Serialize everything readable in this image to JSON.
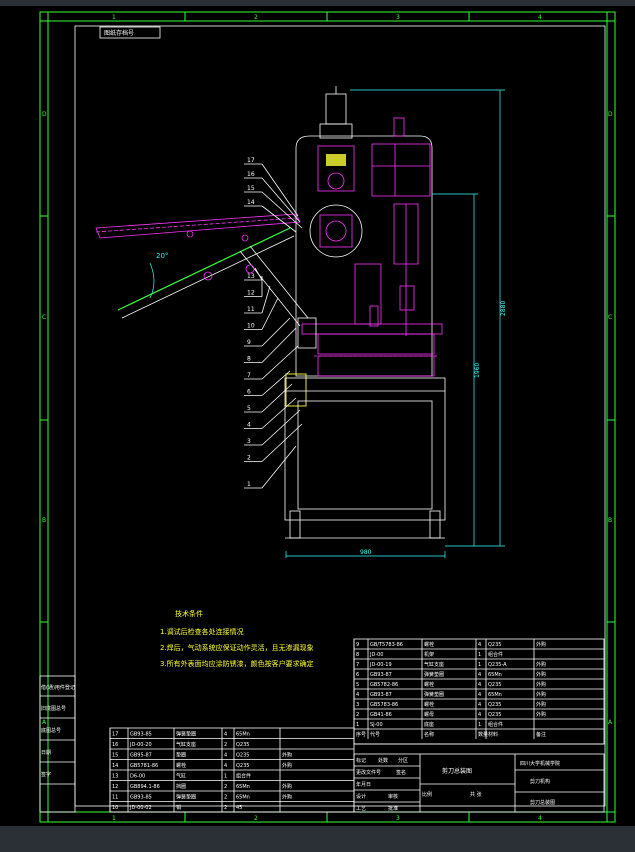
{
  "frame": {
    "top_zones": [
      "1",
      "2",
      "3",
      "4"
    ],
    "bottom_zones": [
      "1",
      "2",
      "3",
      "4"
    ],
    "left_zones": [
      "D",
      "C",
      "B",
      "A"
    ],
    "right_zones": [
      "D",
      "C",
      "B",
      "A"
    ]
  },
  "stamp_top_left": "图纸存档号",
  "dimensions": {
    "overall_height": "2880",
    "lower_height": "1960",
    "width": "980",
    "angle": "20°"
  },
  "balloons": [
    "17",
    "16",
    "15",
    "14",
    "13",
    "12",
    "11",
    "10",
    "9",
    "8",
    "7",
    "6",
    "5",
    "4",
    "3",
    "2",
    "1"
  ],
  "notes": {
    "title": "技术条件",
    "lines": [
      "1.调试后检查各处连接情况",
      "2.焊后，气动系统应保证动作灵活，且无渗漏现象",
      "3.所有外表面均应涂防锈漆，颜色按客户要求确定"
    ]
  },
  "left_strip": [
    "借(通)用件登记",
    "旧底图总号",
    "底图总号",
    "日期",
    "签字"
  ],
  "bom_left": {
    "rows": [
      {
        "no": "17",
        "code": "GB93-85",
        "name": "弹簧垫圈",
        "qty": "4",
        "material": "65Mn",
        "remark": ""
      },
      {
        "no": "16",
        "code": "JD-00-20",
        "name": "气缸支座",
        "qty": "2",
        "material": "Q235",
        "remark": ""
      },
      {
        "no": "15",
        "code": "GB95-87",
        "name": "垫圈",
        "qty": "4",
        "material": "Q235",
        "remark": "外购"
      },
      {
        "no": "14",
        "code": "GB5781-86",
        "name": "螺栓",
        "qty": "4",
        "material": "Q235",
        "remark": "外购"
      },
      {
        "no": "13",
        "code": "D6-00",
        "name": "气缸",
        "qty": "1",
        "material": "组合件",
        "remark": ""
      },
      {
        "no": "12",
        "code": "GB894.1-86",
        "name": "挡圈",
        "qty": "2",
        "material": "65Mn",
        "remark": "外购"
      },
      {
        "no": "11",
        "code": "GB93-85",
        "name": "弹簧垫圈",
        "qty": "2",
        "material": "65Mn",
        "remark": "外购"
      },
      {
        "no": "10",
        "code": "JD-00-02",
        "name": "销",
        "qty": "2",
        "material": "45",
        "remark": ""
      }
    ]
  },
  "bom_right": {
    "rows": [
      {
        "no": "9",
        "code": "GB/T5783-86",
        "name": "螺栓",
        "qty": "4",
        "material": "Q235",
        "remark": "外购"
      },
      {
        "no": "8",
        "code": "JD-00",
        "name": "机架",
        "qty": "1",
        "material": "组合件",
        "remark": ""
      },
      {
        "no": "7",
        "code": "JD-00-19",
        "name": "气缸支座",
        "qty": "1",
        "material": "Q235-A",
        "remark": "外购"
      },
      {
        "no": "6",
        "code": "GB93-87",
        "name": "弹簧垫圈",
        "qty": "4",
        "material": "65Mn",
        "remark": "外购"
      },
      {
        "no": "5",
        "code": "GB5782-86",
        "name": "螺栓",
        "qty": "4",
        "material": "Q235",
        "remark": "外购"
      },
      {
        "no": "4",
        "code": "GB93-87",
        "name": "弹簧垫圈",
        "qty": "4",
        "material": "65Mn",
        "remark": "外购"
      },
      {
        "no": "3",
        "code": "GB5783-86",
        "name": "螺栓",
        "qty": "4",
        "material": "Q235",
        "remark": "外购"
      },
      {
        "no": "2",
        "code": "GB41-86",
        "name": "螺母",
        "qty": "4",
        "material": "Q235",
        "remark": "外购"
      },
      {
        "no": "1",
        "code": "SJ-00",
        "name": "底座",
        "qty": "1",
        "material": "组合件",
        "remark": ""
      }
    ],
    "header": {
      "no": "序号",
      "code": "代号",
      "name": "名称",
      "qty": "数量",
      "material": "材料",
      "remark": "备注"
    }
  },
  "title_block": {
    "drawing_name": "剪刀总装图",
    "company": "四川大学机械学院",
    "subtitle": "剪刀机构",
    "doc_title": "剪刀总装图",
    "scale_label": "比例",
    "sheet_label": "共 张",
    "labels": [
      "标记",
      "处数",
      "分区",
      "更改文件号",
      "签名",
      "年月日",
      "设计",
      "审核",
      "工艺",
      "批准"
    ]
  }
}
